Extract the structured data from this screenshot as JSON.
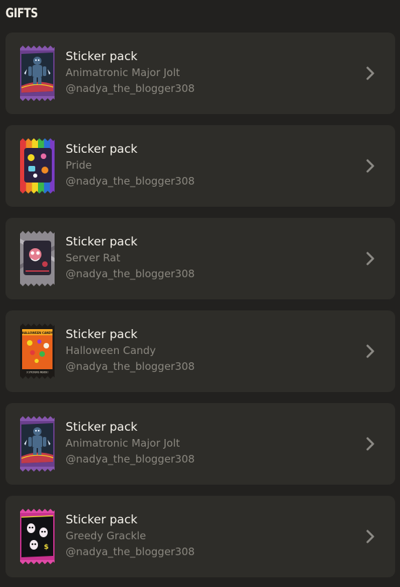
{
  "section": {
    "title": "GIFTS"
  },
  "gifts": [
    {
      "title": "Sticker pack",
      "name": "Animatronic Major Jolt",
      "sender": "@nadya_the_blogger308",
      "theme": "purple-jolt",
      "colors": [
        "#6a3f8c",
        "#1f2b3a",
        "#4a6a8a"
      ]
    },
    {
      "title": "Sticker pack",
      "name": "Pride",
      "sender": "@nadya_the_blogger308",
      "theme": "rainbow",
      "colors": [
        "#e23b3b",
        "#f08a24",
        "#f2d522",
        "#3bb54a",
        "#2a6fd6",
        "#7a3cc4"
      ]
    },
    {
      "title": "Sticker pack",
      "name": "Server Rat",
      "sender": "@nadya_the_blogger308",
      "theme": "grey-rat",
      "colors": [
        "#8e8a90",
        "#2a2633",
        "#c23b4a"
      ]
    },
    {
      "title": "Sticker pack",
      "name": "Halloween Candy",
      "sender": "@nadya_the_blogger308",
      "theme": "orange-candy",
      "colors": [
        "#1d1a17",
        "#e8621c",
        "#f5a623"
      ],
      "pack_header": "HALLOWEEN CANDY",
      "pack_footer": "3 STICKERS INSIDE!"
    },
    {
      "title": "Sticker pack",
      "name": "Animatronic Major Jolt",
      "sender": "@nadya_the_blogger308",
      "theme": "purple-jolt",
      "colors": [
        "#6a3f8c",
        "#1f2b3a",
        "#4a6a8a"
      ]
    },
    {
      "title": "Sticker pack",
      "name": "Greedy Grackle",
      "sender": "@nadya_the_blogger308",
      "theme": "pink-grackle",
      "colors": [
        "#c8318f",
        "#111014",
        "#e6d23a"
      ]
    }
  ],
  "icons": {
    "chevron": "chevron-right-icon"
  },
  "palette": {
    "background": "#22211f",
    "card": "#2e2d29",
    "title_text": "#f4f1ea",
    "secondary_text": "#8a877f",
    "chevron": "#8c8a85"
  }
}
